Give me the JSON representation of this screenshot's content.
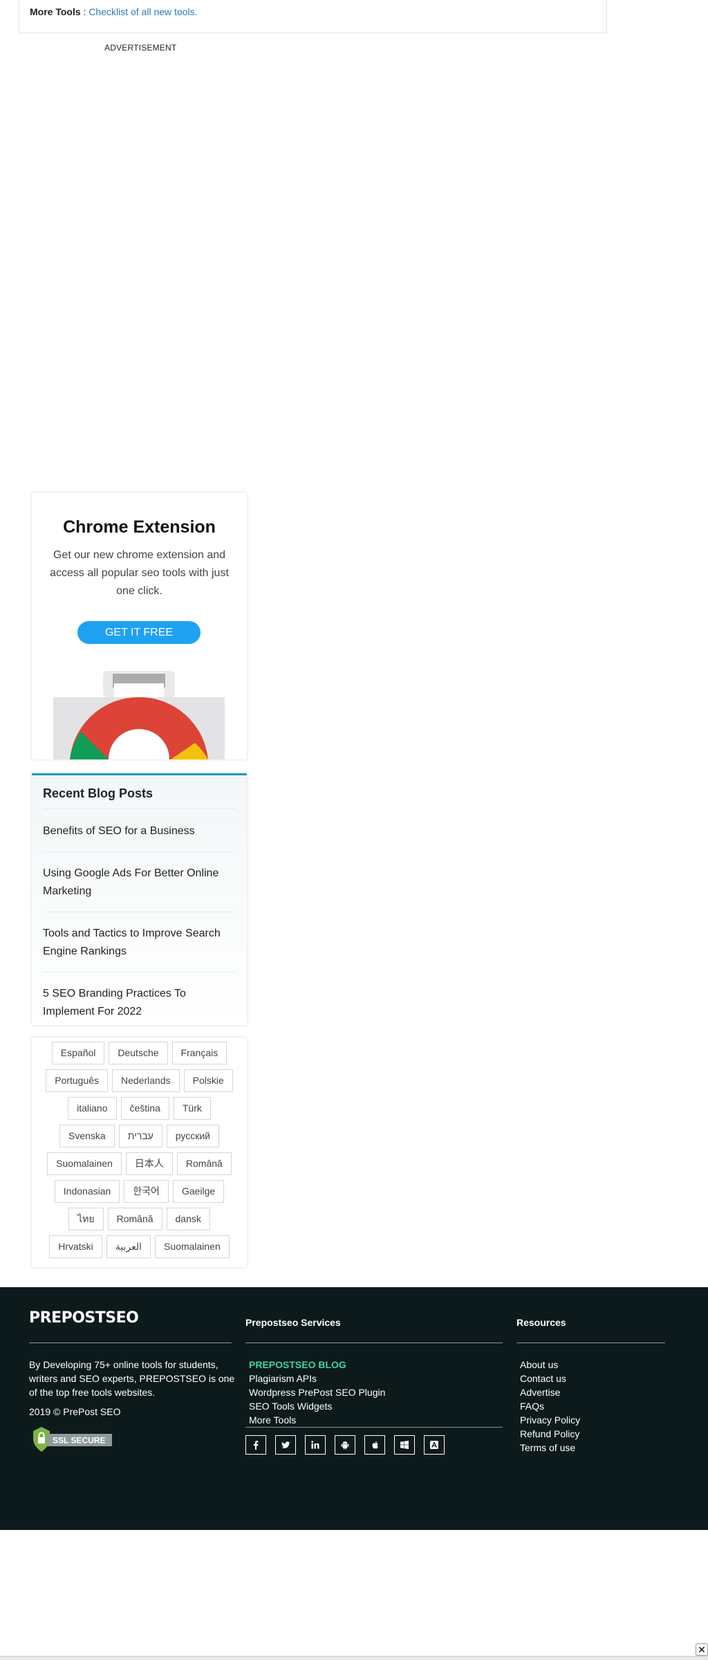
{
  "more_tools": {
    "label": "More Tools",
    "separator": " : ",
    "link": "Checklist of all new tools."
  },
  "ad_label": "ADVERTISEMENT",
  "chrome_ext": {
    "title": "Chrome Extension",
    "description": "Get our new chrome extension and access all popular seo tools with just one click.",
    "button": "GET IT FREE"
  },
  "blog": {
    "title": "Recent Blog Posts",
    "posts": [
      "Benefits of SEO for a Business",
      "Using Google Ads For Better Online Marketing",
      "Tools and Tactics to Improve Search Engine Rankings",
      "5 SEO Branding Practices To Implement For 2022"
    ]
  },
  "languages": [
    "Español",
    "Deutsche",
    "Français",
    "Português",
    "Nederlands",
    "Polskie",
    "italiano",
    "čeština",
    "Türk",
    "Svenska",
    "עברית",
    "русский",
    "Suomalainen",
    "日本人",
    "Română",
    "Indonasian",
    "한국어",
    "Gaeilge",
    "ไทย",
    "Română",
    "dansk",
    "Hrvatski",
    "العربية",
    "Suomalainen"
  ],
  "footer": {
    "logo": "PREPOSTSEO",
    "about": "By Developing 75+ online tools for students, writers and SEO experts, PREPOSTSEO is one of the top free tools websites.",
    "copyright": "2019 © PrePost SEO",
    "ssl_text": "SSL SECURE",
    "services_title": "Prepostseo Services",
    "services": [
      "PREPOSTSEO BLOG",
      "Plagiarism APIs",
      "Wordpress PrePost SEO Plugin",
      "SEO Tools Widgets",
      "More Tools"
    ],
    "resources_title": "Resources",
    "resources": [
      "About us",
      "Contact us",
      "Advertise",
      "FAQs",
      "Privacy Policy",
      "Refund Policy",
      "Terms of use"
    ],
    "social_icons": [
      "facebook-icon",
      "twitter-icon",
      "linkedin-icon",
      "android-icon",
      "apple-icon",
      "windows-icon",
      "app-store-icon"
    ]
  },
  "close_glyph": "✕"
}
